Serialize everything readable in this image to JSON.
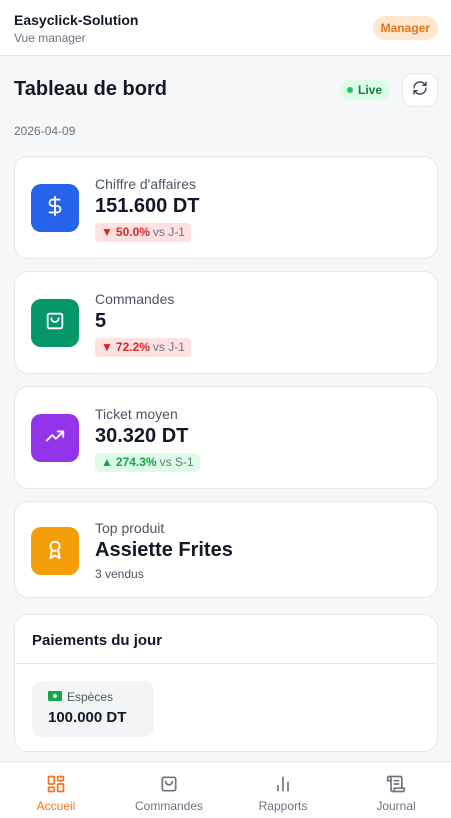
{
  "header": {
    "app_name": "Easyclick-Solution",
    "subtitle": "Vue manager",
    "role": "Manager"
  },
  "dashboard": {
    "title": "Tableau de bord",
    "live_label": "Live",
    "date": "2026-04-09"
  },
  "kpis": [
    {
      "label": "Chiffre d'affaires",
      "value": "151.600 DT",
      "delta": "50.0%",
      "compare": "vs J-1",
      "trend": "down",
      "icon": "dollar-icon",
      "color": "#2563eb"
    },
    {
      "label": "Commandes",
      "value": "5",
      "delta": "72.2%",
      "compare": "vs J-1",
      "trend": "down",
      "icon": "shopping-bag-icon",
      "color": "#059669"
    },
    {
      "label": "Ticket moyen",
      "value": "30.320 DT",
      "delta": "274.3%",
      "compare": "vs S-1",
      "trend": "up",
      "icon": "trending-up-icon",
      "color": "#9333ea"
    }
  ],
  "top_product": {
    "label": "Top produit",
    "name": "Assiette Frites",
    "sold": "3 vendus",
    "icon": "award-icon",
    "color": "#f59e0b"
  },
  "payments": {
    "title": "Paiements du jour",
    "items": [
      {
        "label": "Espèces",
        "value": "100.000 DT",
        "icon": "cash-icon"
      }
    ]
  },
  "nav": [
    {
      "label": "Accueil",
      "icon": "dashboard-icon",
      "active": true
    },
    {
      "label": "Commandes",
      "icon": "shopping-bag-icon",
      "active": false
    },
    {
      "label": "Rapports",
      "icon": "bar-chart-icon",
      "active": false
    },
    {
      "label": "Journal",
      "icon": "scroll-icon",
      "active": false
    }
  ],
  "colors": {
    "accent": "#f97316",
    "up": "#16a34a",
    "down": "#dc2626",
    "live": "#22c55e"
  }
}
